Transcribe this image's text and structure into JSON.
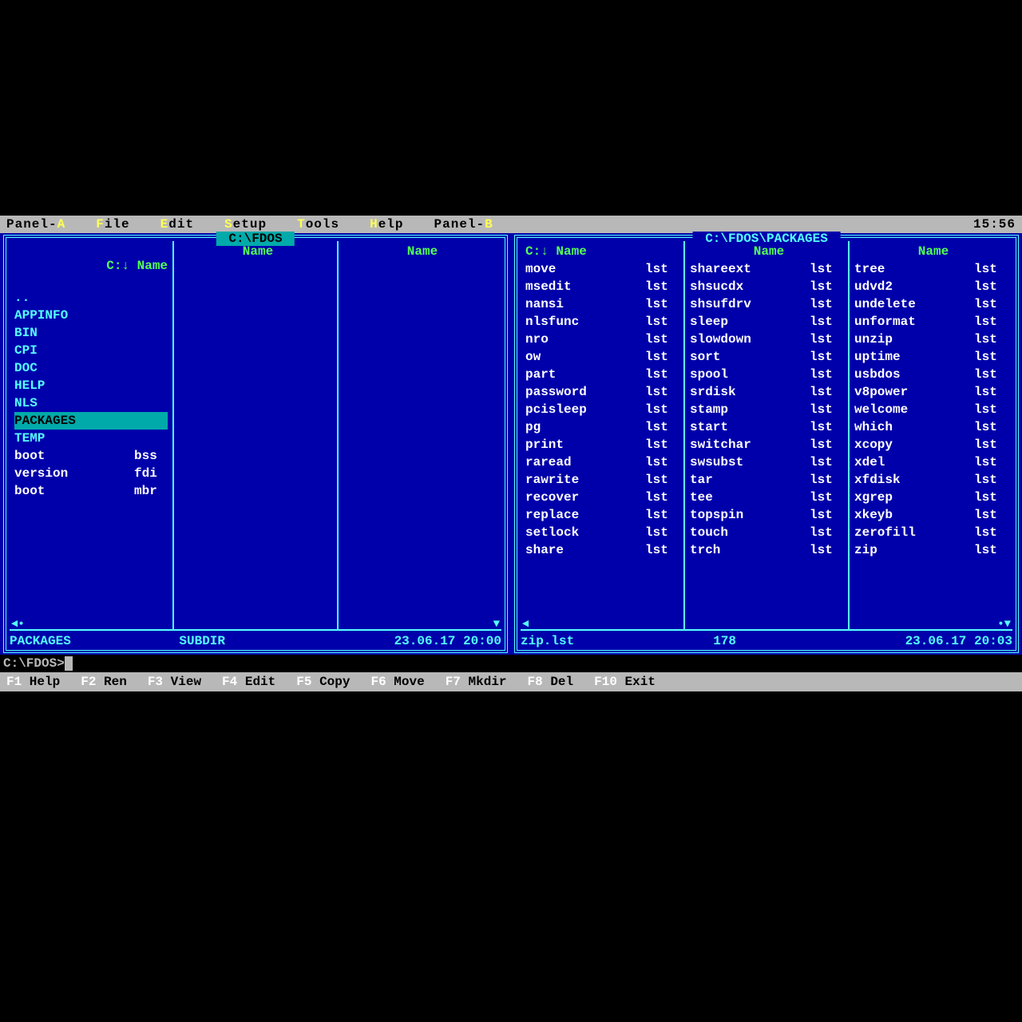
{
  "menubar": {
    "items": [
      {
        "hotkey": "A",
        "before": "Panel-",
        "after": ""
      },
      {
        "hotkey": "F",
        "before": "",
        "after": "ile"
      },
      {
        "hotkey": "E",
        "before": "",
        "after": "dit"
      },
      {
        "hotkey": "S",
        "before": "",
        "after": "etup"
      },
      {
        "hotkey": "T",
        "before": "",
        "after": "ools"
      },
      {
        "hotkey": "H",
        "before": "",
        "after": "elp"
      },
      {
        "hotkey": "B",
        "before": "Panel-",
        "after": ""
      }
    ],
    "clock": "15:56"
  },
  "left_panel": {
    "title": " C:\\FDOS ",
    "active": true,
    "sort_header": "C:↓ Name",
    "col_headers": [
      "Name",
      "Name"
    ],
    "files": [
      {
        "name": "..",
        "ext": "",
        "type": "dir"
      },
      {
        "name": "APPINFO",
        "ext": "",
        "type": "dir"
      },
      {
        "name": "BIN",
        "ext": "",
        "type": "dir"
      },
      {
        "name": "CPI",
        "ext": "",
        "type": "dir"
      },
      {
        "name": "DOC",
        "ext": "",
        "type": "dir"
      },
      {
        "name": "HELP",
        "ext": "",
        "type": "dir"
      },
      {
        "name": "NLS",
        "ext": "",
        "type": "dir"
      },
      {
        "name": "PACKAGES",
        "ext": "",
        "type": "dir",
        "selected": true
      },
      {
        "name": "TEMP",
        "ext": "",
        "type": "dir"
      },
      {
        "name": "boot",
        "ext": "bss",
        "type": "file"
      },
      {
        "name": "version",
        "ext": "fdi",
        "type": "file"
      },
      {
        "name": "boot",
        "ext": "mbr",
        "type": "file"
      }
    ],
    "status": {
      "name": "PACKAGES",
      "size": "SUBDIR",
      "datetime": "23.06.17 20:00"
    }
  },
  "right_panel": {
    "title": " C:\\FDOS\\PACKAGES ",
    "active": false,
    "sort_header": "C:↓ Name",
    "col_headers": [
      "Name",
      "Name"
    ],
    "columns": [
      [
        {
          "name": "move",
          "ext": "lst"
        },
        {
          "name": "msedit",
          "ext": "lst"
        },
        {
          "name": "nansi",
          "ext": "lst"
        },
        {
          "name": "nlsfunc",
          "ext": "lst"
        },
        {
          "name": "nro",
          "ext": "lst"
        },
        {
          "name": "ow",
          "ext": "lst"
        },
        {
          "name": "part",
          "ext": "lst"
        },
        {
          "name": "password",
          "ext": "lst"
        },
        {
          "name": "pcisleep",
          "ext": "lst"
        },
        {
          "name": "pg",
          "ext": "lst"
        },
        {
          "name": "print",
          "ext": "lst"
        },
        {
          "name": "raread",
          "ext": "lst"
        },
        {
          "name": "rawrite",
          "ext": "lst"
        },
        {
          "name": "recover",
          "ext": "lst"
        },
        {
          "name": "replace",
          "ext": "lst"
        },
        {
          "name": "setlock",
          "ext": "lst"
        },
        {
          "name": "share",
          "ext": "lst"
        }
      ],
      [
        {
          "name": "shareext",
          "ext": "lst"
        },
        {
          "name": "shsucdx",
          "ext": "lst"
        },
        {
          "name": "shsufdrv",
          "ext": "lst"
        },
        {
          "name": "sleep",
          "ext": "lst"
        },
        {
          "name": "slowdown",
          "ext": "lst"
        },
        {
          "name": "sort",
          "ext": "lst"
        },
        {
          "name": "spool",
          "ext": "lst"
        },
        {
          "name": "srdisk",
          "ext": "lst"
        },
        {
          "name": "stamp",
          "ext": "lst"
        },
        {
          "name": "start",
          "ext": "lst"
        },
        {
          "name": "switchar",
          "ext": "lst"
        },
        {
          "name": "swsubst",
          "ext": "lst"
        },
        {
          "name": "tar",
          "ext": "lst"
        },
        {
          "name": "tee",
          "ext": "lst"
        },
        {
          "name": "topspin",
          "ext": "lst"
        },
        {
          "name": "touch",
          "ext": "lst"
        },
        {
          "name": "trch",
          "ext": "lst"
        }
      ],
      [
        {
          "name": "tree",
          "ext": "lst"
        },
        {
          "name": "udvd2",
          "ext": "lst"
        },
        {
          "name": "undelete",
          "ext": "lst"
        },
        {
          "name": "unformat",
          "ext": "lst"
        },
        {
          "name": "unzip",
          "ext": "lst"
        },
        {
          "name": "uptime",
          "ext": "lst"
        },
        {
          "name": "usbdos",
          "ext": "lst"
        },
        {
          "name": "v8power",
          "ext": "lst"
        },
        {
          "name": "welcome",
          "ext": "lst"
        },
        {
          "name": "which",
          "ext": "lst"
        },
        {
          "name": "xcopy",
          "ext": "lst"
        },
        {
          "name": "xdel",
          "ext": "lst"
        },
        {
          "name": "xfdisk",
          "ext": "lst"
        },
        {
          "name": "xgrep",
          "ext": "lst"
        },
        {
          "name": "xkeyb",
          "ext": "lst"
        },
        {
          "name": "zerofill",
          "ext": "lst"
        },
        {
          "name": "zip",
          "ext": "lst"
        }
      ]
    ],
    "status": {
      "name": "zip.lst",
      "size": "178",
      "datetime": "23.06.17 20:03"
    }
  },
  "cmdline": {
    "prompt": "C:\\FDOS>"
  },
  "fkeys": [
    {
      "key": "F1",
      "label": " Help"
    },
    {
      "key": "F2",
      "label": " Ren"
    },
    {
      "key": "F3",
      "label": " View"
    },
    {
      "key": "F4",
      "label": " Edit"
    },
    {
      "key": "F5",
      "label": " Copy"
    },
    {
      "key": "F6",
      "label": " Move"
    },
    {
      "key": "F7",
      "label": " Mkdir"
    },
    {
      "key": "F8",
      "label": " Del"
    },
    {
      "key": "F10",
      "label": " Exit"
    }
  ]
}
